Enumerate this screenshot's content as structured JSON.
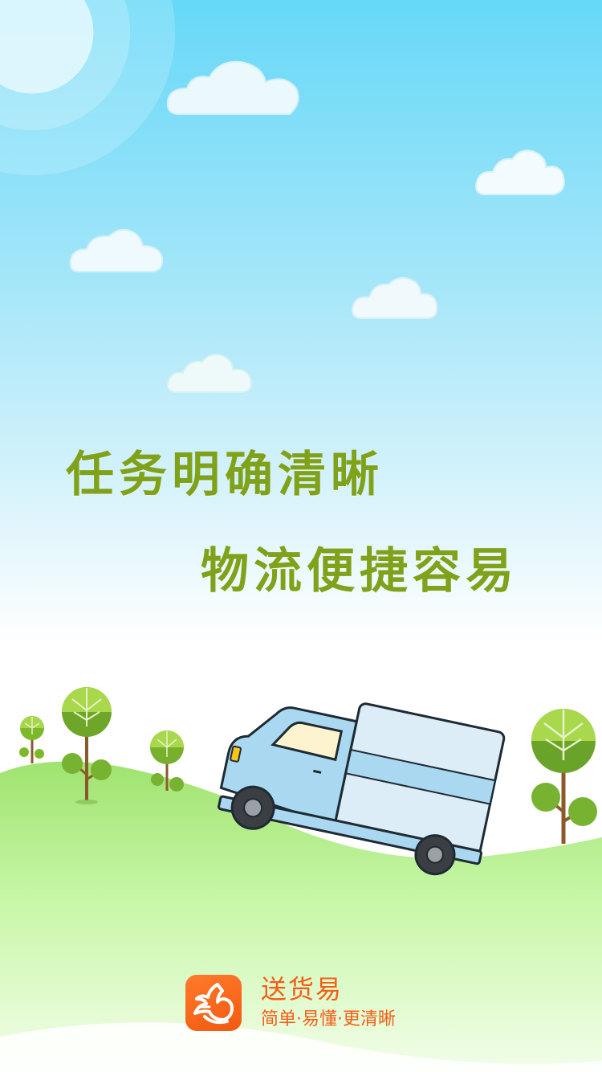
{
  "splash": {
    "slogan_line_1": "任务明确清晰",
    "slogan_line_2": "物流便捷容易"
  },
  "brand": {
    "name": "送货易",
    "tagline": "简单·易懂·更清晰",
    "logo_icon": "running-rabbit-icon"
  },
  "colors": {
    "sky_top": "#66d8f8",
    "slogan": "#7fa21a",
    "hill": "#c5f7a5",
    "brand_orange": "#f25e17",
    "truck_body": "#a9d8f0"
  }
}
